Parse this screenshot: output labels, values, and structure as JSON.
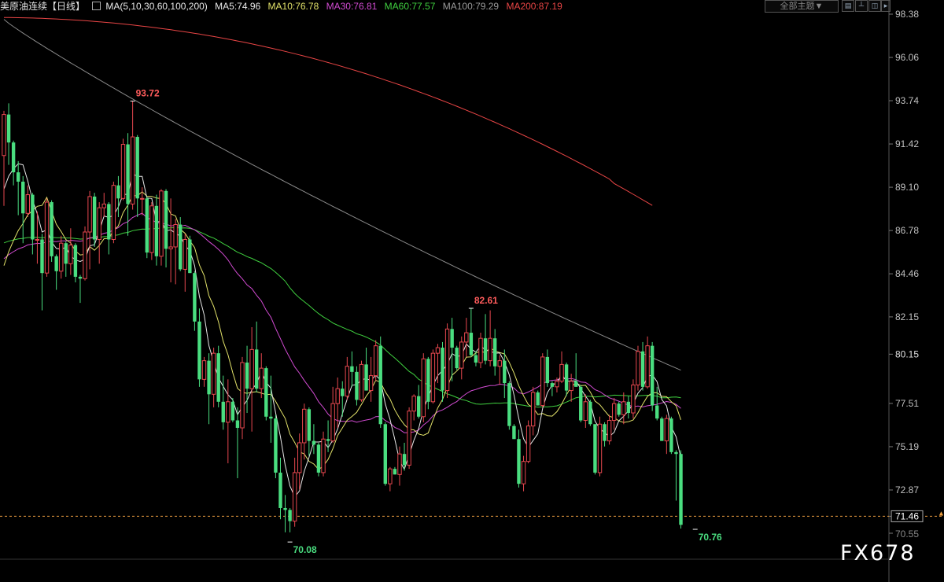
{
  "header": {
    "instrument": "美原油连续",
    "period": "【日线】",
    "ma_params": "MA(5,10,30,60,100,200)",
    "ma_values": [
      {
        "label": "MA5:74.96",
        "color": "#e8e8e8"
      },
      {
        "label": "MA10:76.78",
        "color": "#e3e36a"
      },
      {
        "label": "MA30:76.81",
        "color": "#d24bd2"
      },
      {
        "label": "MA60:77.57",
        "color": "#3fcf3f"
      },
      {
        "label": "MA100:79.29",
        "color": "#9a9a9a"
      },
      {
        "label": "MA200:87.19",
        "color": "#e84545"
      }
    ],
    "theme_button": "全部主题▼"
  },
  "watermark": "FX678",
  "chart_data": {
    "type": "candlestick",
    "ylim": [
      70.2,
      98.6
    ],
    "y_ticks": [
      "98.38",
      "96.06",
      "93.74",
      "91.42",
      "89.10",
      "86.78",
      "84.46",
      "82.15",
      "80.15",
      "77.51",
      "75.19",
      "72.87",
      "71.46",
      "70.55"
    ],
    "last_price": 71.46,
    "annotations": [
      {
        "text": "93.72",
        "price": 93.72,
        "bar": 27,
        "color": "#ff5c5c"
      },
      {
        "text": "82.61",
        "price": 82.61,
        "bar": 98,
        "color": "#ff5c5c"
      },
      {
        "text": "70.08",
        "price": 70.08,
        "bar": 60,
        "color": "#4ade80"
      },
      {
        "text": "70.76",
        "price": 70.76,
        "bar": 145,
        "color": "#4ade80"
      }
    ],
    "colors": {
      "up": "#e8484f",
      "down": "#4ade80",
      "grid": "#303030",
      "axis_text": "#c0c0c0",
      "last_price_line": "#f0a040"
    },
    "candles": [
      [
        90.8,
        93.2,
        88.1,
        93.0
      ],
      [
        93.0,
        93.6,
        90.3,
        91.5
      ],
      [
        91.5,
        91.6,
        89.2,
        89.9
      ],
      [
        89.9,
        90.5,
        87.6,
        89.4
      ],
      [
        89.4,
        89.7,
        86.1,
        87.7
      ],
      [
        87.7,
        89.2,
        87.5,
        88.7
      ],
      [
        88.7,
        88.8,
        85.5,
        86.3
      ],
      [
        86.3,
        87.8,
        85.0,
        86.3
      ],
      [
        86.3,
        86.6,
        82.5,
        84.5
      ],
      [
        84.5,
        88.5,
        84.3,
        88.3
      ],
      [
        88.3,
        88.4,
        85.1,
        85.4
      ],
      [
        85.4,
        85.5,
        83.6,
        84.6
      ],
      [
        84.6,
        86.5,
        84.2,
        86.1
      ],
      [
        86.1,
        86.2,
        84.3,
        85.0
      ],
      [
        85.0,
        86.9,
        84.4,
        86.0
      ],
      [
        86.0,
        86.1,
        84.0,
        84.3
      ],
      [
        84.3,
        84.4,
        82.9,
        84.2
      ],
      [
        84.2,
        87.0,
        84.1,
        86.7
      ],
      [
        86.7,
        88.9,
        84.7,
        88.6
      ],
      [
        88.6,
        88.8,
        85.9,
        86.3
      ],
      [
        86.3,
        88.3,
        85.0,
        88.0
      ],
      [
        88.0,
        88.8,
        87.5,
        88.2
      ],
      [
        88.2,
        88.3,
        85.5,
        86.3
      ],
      [
        86.3,
        89.4,
        86.1,
        89.2
      ],
      [
        89.2,
        89.7,
        87.5,
        88.5
      ],
      [
        88.5,
        91.7,
        88.4,
        91.4
      ],
      [
        91.4,
        92.0,
        86.5,
        88.2
      ],
      [
        88.2,
        93.7,
        87.9,
        91.8
      ],
      [
        91.8,
        91.9,
        87.5,
        88.5
      ],
      [
        88.5,
        89.1,
        87.6,
        88.5
      ],
      [
        88.5,
        88.6,
        85.3,
        85.6
      ],
      [
        85.6,
        88.3,
        85.2,
        88.1
      ],
      [
        88.1,
        88.7,
        84.9,
        85.4
      ],
      [
        85.4,
        89.0,
        84.9,
        88.9
      ],
      [
        88.9,
        89.0,
        84.8,
        85.8
      ],
      [
        85.8,
        88.5,
        84.0,
        85.9
      ],
      [
        85.9,
        87.4,
        83.9,
        87.1
      ],
      [
        87.1,
        87.5,
        84.6,
        84.7
      ],
      [
        84.7,
        86.6,
        83.5,
        86.3
      ],
      [
        86.3,
        86.5,
        84.5,
        84.5
      ],
      [
        84.5,
        84.6,
        81.4,
        81.9
      ],
      [
        81.9,
        82.6,
        78.4,
        78.8
      ],
      [
        78.8,
        80.0,
        78.4,
        79.8
      ],
      [
        79.8,
        80.2,
        76.4,
        78.0
      ],
      [
        78.0,
        80.5,
        77.3,
        80.2
      ],
      [
        80.2,
        80.6,
        77.3,
        77.6
      ],
      [
        77.6,
        79.0,
        76.1,
        76.5
      ],
      [
        76.5,
        78.8,
        74.3,
        77.6
      ],
      [
        77.6,
        77.8,
        76.5,
        76.6
      ],
      [
        76.6,
        77.3,
        73.5,
        76.2
      ],
      [
        76.2,
        80.0,
        75.6,
        79.7
      ],
      [
        79.7,
        80.6,
        77.0,
        78.3
      ],
      [
        78.3,
        81.6,
        76.0,
        80.4
      ],
      [
        80.4,
        81.9,
        78.1,
        78.3
      ],
      [
        78.3,
        80.2,
        77.8,
        79.4
      ],
      [
        79.4,
        79.5,
        76.6,
        76.8
      ],
      [
        76.8,
        79.0,
        75.4,
        76.7
      ],
      [
        76.7,
        76.9,
        73.5,
        73.8
      ],
      [
        73.8,
        74.6,
        71.3,
        71.9
      ],
      [
        71.9,
        72.6,
        70.6,
        71.8
      ],
      [
        71.8,
        71.9,
        70.6,
        71.2
      ],
      [
        71.2,
        74.6,
        70.9,
        73.8
      ],
      [
        73.8,
        75.9,
        72.9,
        75.4
      ],
      [
        75.4,
        77.5,
        74.5,
        77.2
      ],
      [
        77.2,
        77.3,
        74.7,
        75.5
      ],
      [
        75.5,
        76.4,
        74.8,
        75.3
      ],
      [
        75.3,
        75.4,
        73.6,
        73.8
      ],
      [
        73.8,
        76.0,
        73.6,
        75.6
      ],
      [
        75.6,
        76.6,
        74.9,
        75.5
      ],
      [
        75.5,
        78.4,
        75.4,
        77.5
      ],
      [
        77.5,
        78.9,
        76.2,
        78.3
      ],
      [
        78.3,
        78.7,
        76.8,
        77.9
      ],
      [
        77.9,
        80.0,
        77.7,
        79.5
      ],
      [
        79.5,
        80.3,
        78.4,
        79.2
      ],
      [
        79.2,
        79.5,
        77.4,
        77.7
      ],
      [
        77.7,
        79.8,
        77.6,
        79.6
      ],
      [
        79.6,
        80.5,
        78.2,
        78.2
      ],
      [
        78.2,
        80.0,
        77.6,
        79.0
      ],
      [
        79.0,
        80.9,
        78.7,
        80.6
      ],
      [
        80.6,
        81.1,
        76.2,
        76.4
      ],
      [
        76.4,
        76.5,
        73.1,
        73.2
      ],
      [
        73.2,
        74.1,
        72.8,
        74.0
      ],
      [
        74.0,
        74.1,
        73.7,
        73.7
      ],
      [
        73.7,
        75.2,
        73.1,
        74.8
      ],
      [
        74.8,
        75.4,
        73.9,
        74.2
      ],
      [
        74.2,
        77.3,
        74.0,
        77.1
      ],
      [
        77.1,
        78.0,
        76.6,
        77.9
      ],
      [
        77.9,
        78.5,
        76.7,
        76.8
      ],
      [
        76.8,
        80.2,
        76.5,
        79.9
      ],
      [
        79.9,
        80.0,
        77.2,
        77.6
      ],
      [
        77.6,
        80.4,
        77.5,
        80.2
      ],
      [
        80.2,
        80.7,
        78.6,
        80.5
      ],
      [
        80.5,
        80.8,
        77.6,
        78.2
      ],
      [
        78.2,
        81.8,
        77.8,
        81.5
      ],
      [
        81.5,
        82.1,
        78.7,
        80.5
      ],
      [
        80.5,
        80.6,
        79.3,
        79.4
      ],
      [
        79.4,
        81.1,
        78.8,
        80.8
      ],
      [
        80.8,
        82.1,
        80.0,
        81.3
      ],
      [
        81.3,
        82.6,
        80.0,
        80.1
      ],
      [
        80.1,
        80.3,
        79.5,
        79.7
      ],
      [
        79.7,
        81.3,
        79.4,
        81.0
      ],
      [
        81.0,
        82.3,
        79.6,
        79.8
      ],
      [
        79.8,
        82.5,
        79.5,
        81.0
      ],
      [
        81.0,
        81.5,
        79.0,
        79.5
      ],
      [
        79.5,
        80.1,
        78.5,
        79.8
      ],
      [
        79.8,
        80.4,
        77.8,
        78.6
      ],
      [
        78.6,
        78.7,
        76.1,
        76.3
      ],
      [
        76.3,
        76.4,
        75.6,
        75.6
      ],
      [
        75.6,
        76.1,
        73.0,
        73.2
      ],
      [
        73.2,
        74.7,
        72.8,
        74.4
      ],
      [
        74.4,
        76.6,
        74.3,
        76.3
      ],
      [
        76.3,
        78.4,
        75.8,
        78.1
      ],
      [
        78.1,
        78.2,
        77.4,
        77.4
      ],
      [
        77.4,
        80.2,
        77.3,
        80.0
      ],
      [
        80.0,
        80.4,
        78.4,
        78.6
      ],
      [
        78.6,
        78.7,
        77.9,
        78.4
      ],
      [
        78.4,
        78.9,
        78.1,
        78.7
      ],
      [
        78.7,
        80.3,
        78.6,
        79.6
      ],
      [
        79.6,
        79.7,
        77.9,
        78.2
      ],
      [
        78.2,
        79.1,
        77.6,
        78.7
      ],
      [
        78.7,
        80.2,
        78.4,
        78.4
      ],
      [
        78.4,
        78.5,
        76.5,
        76.6
      ],
      [
        76.6,
        78.0,
        76.2,
        77.6
      ],
      [
        77.6,
        77.7,
        76.3,
        76.4
      ],
      [
        76.4,
        76.4,
        73.7,
        73.8
      ],
      [
        73.8,
        76.8,
        73.6,
        76.4
      ],
      [
        76.4,
        76.5,
        75.2,
        75.5
      ],
      [
        75.5,
        76.9,
        75.3,
        76.6
      ],
      [
        76.6,
        77.8,
        76.1,
        77.5
      ],
      [
        77.5,
        77.6,
        76.8,
        76.9
      ],
      [
        76.9,
        78.1,
        76.4,
        77.6
      ],
      [
        77.6,
        77.9,
        76.7,
        77.0
      ],
      [
        77.0,
        78.8,
        76.7,
        78.5
      ],
      [
        78.5,
        80.6,
        78.2,
        80.3
      ],
      [
        80.3,
        80.8,
        78.2,
        78.4
      ],
      [
        78.4,
        81.1,
        78.3,
        80.6
      ],
      [
        80.6,
        80.8,
        77.1,
        77.4
      ],
      [
        77.4,
        78.4,
        76.6,
        76.7
      ],
      [
        76.7,
        76.8,
        75.5,
        75.5
      ],
      [
        75.5,
        76.9,
        74.8,
        76.7
      ],
      [
        76.7,
        76.8,
        74.8,
        74.9
      ],
      [
        74.9,
        75.0,
        72.3,
        74.8
      ],
      [
        74.8,
        75.0,
        70.8,
        71.0
      ]
    ]
  }
}
